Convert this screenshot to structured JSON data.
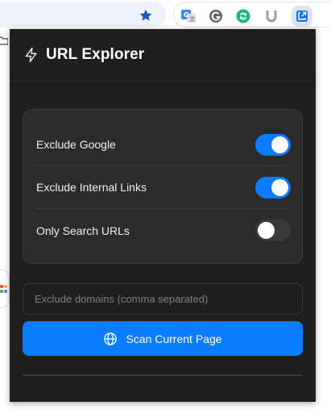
{
  "browser": {
    "icons": {
      "bookmark": "star-icon",
      "extensions": [
        "google-translate-icon",
        "grammarly-icon",
        "sync-extension-icon",
        "u-extension-icon",
        "url-explorer-extension-icon"
      ]
    },
    "bookmark_color": "#1a56c4"
  },
  "popup": {
    "title": "URL Explorer",
    "title_icon": "bolt-icon",
    "settings": [
      {
        "label": "Exclude Google",
        "enabled": true
      },
      {
        "label": "Exclude Internal Links",
        "enabled": true
      },
      {
        "label": "Only Search URLs",
        "enabled": false
      }
    ],
    "exclude_domains": {
      "value": "",
      "placeholder": "Exclude domains (comma separated)"
    },
    "scan_button": {
      "label": "Scan Current Page",
      "icon": "globe-icon"
    }
  },
  "colors": {
    "popup_background": "#1f1f1f",
    "card_background": "#2b2b2b",
    "accent": "#0a7cff",
    "toggle_off": "#3a3a3a"
  }
}
